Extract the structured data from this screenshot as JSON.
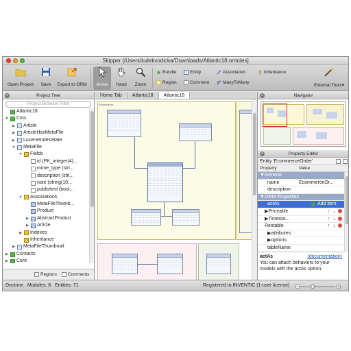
{
  "window": {
    "title": "Skipper [/Users/ludekvodicka/Downloads/Atlantic18.ormdes]"
  },
  "toolbar": {
    "open_project": "Open Project",
    "save": "Save",
    "export": "Export to ORM",
    "arrow": "Arrow",
    "hand": "Hand",
    "zoom": "Zoom",
    "bundle": "Bundle",
    "entity": "Entity",
    "association": "Association",
    "inheritance": "Inheritance",
    "region": "Region",
    "comment": "Comment",
    "many_to_many": "ManyToMany",
    "external_tools": "External Tools"
  },
  "project_tree": {
    "title": "Project Tree",
    "filter_placeholder": "Project Browser Filter",
    "items": [
      {
        "label": "Atlantic18",
        "level": 0,
        "twisty": ""
      },
      {
        "label": "Cms",
        "level": 0,
        "twisty": "▼"
      },
      {
        "label": "Article",
        "level": 1,
        "twisty": "▶"
      },
      {
        "label": "ArticleHasMetaFile",
        "level": 1,
        "twisty": "▶"
      },
      {
        "label": "LuceneIndexState",
        "level": 1,
        "twisty": "▶"
      },
      {
        "label": "MetaFile",
        "level": 1,
        "twisty": "▼"
      },
      {
        "label": "Fields",
        "level": 2,
        "twisty": "▼"
      },
      {
        "label": "id (PK_integer(4)...",
        "level": 3,
        "twisty": ""
      },
      {
        "label": "mime_type (stri...",
        "level": 3,
        "twisty": ""
      },
      {
        "label": "description (stri...",
        "level": 3,
        "twisty": ""
      },
      {
        "label": "note (string(10...",
        "level": 3,
        "twisty": ""
      },
      {
        "label": "published (bool...",
        "level": 3,
        "twisty": ""
      },
      {
        "label": "Associations",
        "level": 2,
        "twisty": "▼"
      },
      {
        "label": "MetaFileThumb...",
        "level": 3,
        "twisty": ""
      },
      {
        "label": "Product",
        "level": 3,
        "twisty": ""
      },
      {
        "label": "AbstractProduct",
        "level": 3,
        "twisty": "▶"
      },
      {
        "label": "Article",
        "level": 3,
        "twisty": "▶"
      },
      {
        "label": "Indexes",
        "level": 2,
        "twisty": "▶"
      },
      {
        "label": "Inheritance",
        "level": 2,
        "twisty": ""
      },
      {
        "label": "MetaFileThumbnail",
        "level": 1,
        "twisty": "▶"
      },
      {
        "label": "Contacts",
        "level": 0,
        "twisty": "▶"
      },
      {
        "label": "Core",
        "level": 0,
        "twisty": "▶"
      },
      {
        "label": "Ecommerce",
        "level": 0,
        "twisty": "▶"
      },
      {
        "label": "pluginPriceable",
        "level": 0,
        "twisty": "▶"
      }
    ],
    "regions_label": "Regions",
    "comments_label": "Comments"
  },
  "tabs": [
    "Home Tab",
    "Atlantic18",
    "Atlantic18"
  ],
  "canvas": {
    "region_label": "Ecommerce"
  },
  "navigator": {
    "title": "Navigator"
  },
  "property_editor": {
    "title": "Property Editor",
    "entity": "Entity 'EcommerceOrder'",
    "col_property": "Property",
    "col_value": "Value",
    "rows": [
      {
        "kind": "group",
        "name": "▼General",
        "value": ""
      },
      {
        "kind": "normal",
        "name": "name",
        "value": "EcommerceOr..."
      },
      {
        "kind": "normal",
        "name": "description",
        "value": ""
      },
      {
        "kind": "group",
        "name": "▼ORM Properties",
        "value": ""
      },
      {
        "kind": "selected",
        "name": "actAs",
        "value": "Add item"
      },
      {
        "kind": "action",
        "name": "▶Priceable",
        "value": ""
      },
      {
        "kind": "action",
        "name": "▶Timesta...",
        "value": ""
      },
      {
        "kind": "action",
        "name": "Restable",
        "value": ""
      },
      {
        "kind": "normal",
        "name": "▶attributes",
        "value": ""
      },
      {
        "kind": "normal",
        "name": "▶options",
        "value": ""
      },
      {
        "kind": "normal",
        "name": "tableName",
        "value": ""
      }
    ],
    "desc_title": "actAs",
    "desc_link": "(documentation)",
    "desc_text": "You can attach behaviors to your models with the actAs option."
  },
  "status": {
    "left": "Doctrine   Modules: 8   Entities: 71",
    "right": "Registered to INVENTIC (1-user license)"
  },
  "colors": {
    "accent": "#3d6ed3",
    "group": "#9aa9c6"
  }
}
